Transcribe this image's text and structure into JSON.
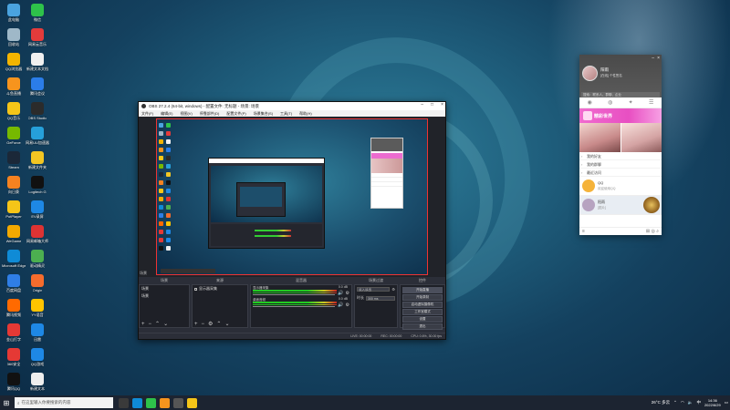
{
  "desktop": {
    "icons": [
      {
        "label": "此电脑",
        "color": "#4aa3df"
      },
      {
        "label": "微信",
        "color": "#2ec24a"
      },
      {
        "label": "回收站",
        "color": "#9fb8c8"
      },
      {
        "label": "网易云音乐",
        "color": "#e33b3b"
      },
      {
        "label": "QQ浏览器",
        "color": "#f4b400"
      },
      {
        "label": "新建文本文档",
        "color": "#f0f0f0"
      },
      {
        "label": "斗鱼直播",
        "color": "#f7941d"
      },
      {
        "label": "腾讯会议",
        "color": "#2b7de9"
      },
      {
        "label": "QQ音乐",
        "color": "#f5c518"
      },
      {
        "label": "OBS Studio",
        "color": "#2b2b2b"
      },
      {
        "label": "GeForce",
        "color": "#76b900"
      },
      {
        "label": "网易UU加速器",
        "color": "#26a0da"
      },
      {
        "label": "Steam",
        "color": "#1b2838"
      },
      {
        "label": "新建文件夹",
        "color": "#f3c623"
      },
      {
        "label": "向日葵",
        "color": "#f58220"
      },
      {
        "label": "Logitech G",
        "color": "#111111"
      },
      {
        "label": "PotPlayer",
        "color": "#f5c518"
      },
      {
        "label": "EV录屏",
        "color": "#1e88e5"
      },
      {
        "label": "WeGame",
        "color": "#f2a900"
      },
      {
        "label": "网易邮箱大师",
        "color": "#d33"
      },
      {
        "label": "Microsoft Edge",
        "color": "#0f8bd6"
      },
      {
        "label": "驱动精灵",
        "color": "#4caf50"
      },
      {
        "label": "百度网盘",
        "color": "#2f7ee6"
      },
      {
        "label": "Origin",
        "color": "#f56c2d"
      },
      {
        "label": "腾讯视频",
        "color": "#ff6a00"
      },
      {
        "label": "YY语音",
        "color": "#ffc400"
      },
      {
        "label": "金山打字",
        "color": "#e53935"
      },
      {
        "label": "迅雷",
        "color": "#1e88e5"
      },
      {
        "label": "360安全",
        "color": "#e53935"
      },
      {
        "label": "QQ游戏",
        "color": "#1e88e5"
      },
      {
        "label": "腾讯QQ",
        "color": "#111111"
      },
      {
        "label": "新建文本",
        "color": "#eeeeee"
      }
    ]
  },
  "obs": {
    "title": "OBS 27.2.4 (64-bit, windows) - 配置文件: 无标题 - 场景: 场景",
    "menu": [
      "文件(F)",
      "编辑(E)",
      "视图(V)",
      "停靠部件(D)",
      "配置文件(P)",
      "场景集合(S)",
      "工具(T)",
      "帮助(H)"
    ],
    "docks": {
      "scenes_label": "场景",
      "sources_label": "来源",
      "mixer_label": "混音器",
      "transitions_label": "场景过渡",
      "controls_label": "控件",
      "scene_item": "场景",
      "source_item": "显示器采集",
      "mixer": [
        {
          "name": "显示器采集",
          "db": "0.0 dB"
        },
        {
          "name": "桌面音频",
          "db": "0.0 dB"
        }
      ],
      "transition": "淡入淡出",
      "duration_label": "时长",
      "duration": "300 ms",
      "controls": [
        "开始直播",
        "开始录制",
        "启动虚拟摄像机",
        "工作室模式",
        "设置",
        "退出"
      ]
    },
    "status": [
      "LIVE: 00:00:00",
      "REC: 00:00:00",
      "CPU: 0.6%, 30.00 fps"
    ]
  },
  "qq": {
    "name": "阳雨",
    "status": "[在线] 个性签名",
    "search_placeholder": "搜索：联系人、群聊、企业",
    "banner": "精彩世界",
    "list": [
      "我的好友",
      "我的群聊",
      "最近访问"
    ],
    "chats": [
      {
        "name": "QQ",
        "msg": "欢迎使用QQ"
      },
      {
        "name": "阳雨",
        "msg": "[图片]"
      }
    ]
  },
  "taskbar": {
    "search": "在这里输入你要搜索的内容",
    "tray_temp": "26°C 多云",
    "time": "14:36",
    "date": "2022/6/29"
  },
  "colors": {
    "obs_bg": "#2b2e38",
    "qq_accent": "#ec6ccf",
    "taskbar": "#1c2431"
  }
}
